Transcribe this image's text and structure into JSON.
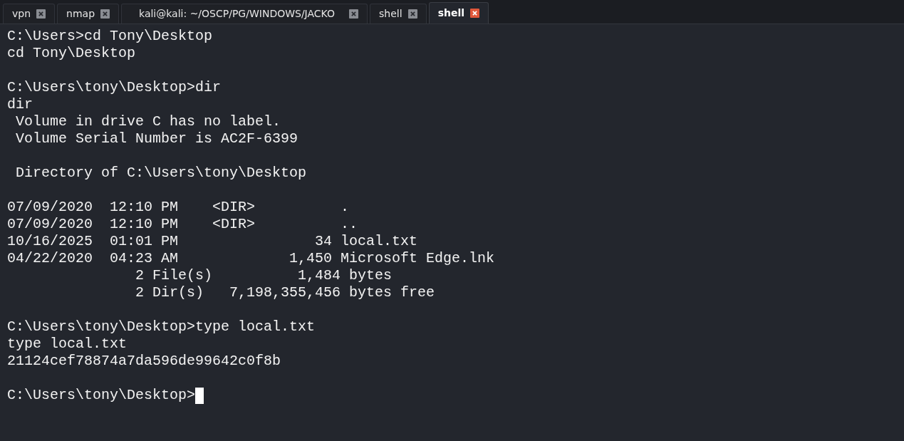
{
  "tabs": [
    {
      "label": "vpn",
      "selected": false
    },
    {
      "label": "nmap",
      "selected": false
    },
    {
      "label": "kali@kali: ~/OSCP/PG/WINDOWS/JACKO",
      "selected": false
    },
    {
      "label": "shell",
      "selected": false
    },
    {
      "label": "shell",
      "selected": true
    }
  ],
  "terminal": {
    "blocks": [
      [
        "C:\\Users>cd Tony\\Desktop",
        "cd Tony\\Desktop"
      ],
      [
        "C:\\Users\\tony\\Desktop>dir",
        "dir",
        " Volume in drive C has no label.",
        " Volume Serial Number is AC2F-6399"
      ],
      [
        " Directory of C:\\Users\\tony\\Desktop"
      ],
      [
        "07/09/2020  12:10 PM    <DIR>          .",
        "07/09/2020  12:10 PM    <DIR>          ..",
        "10/16/2025  01:01 PM                34 local.txt",
        "04/22/2020  04:23 AM             1,450 Microsoft Edge.lnk",
        "               2 File(s)          1,484 bytes",
        "               2 Dir(s)   7,198,355,456 bytes free"
      ],
      [
        "C:\\Users\\tony\\Desktop>type local.txt",
        "type local.txt",
        "21124cef78874a7da596de99642c0f8b"
      ]
    ],
    "prompt": "C:\\Users\\tony\\Desktop>"
  }
}
